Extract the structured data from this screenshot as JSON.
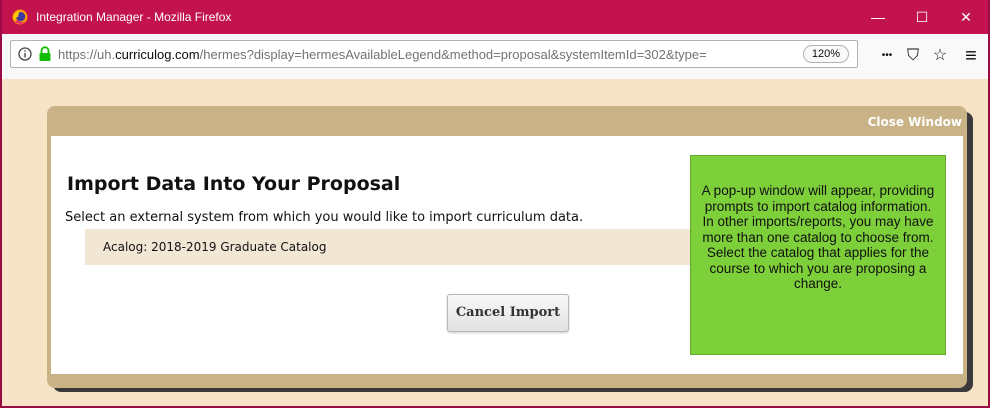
{
  "window": {
    "title": "Integration Manager - Mozilla Firefox",
    "minimize_glyph": "—",
    "maximize_glyph": "☐",
    "close_glyph": "✕"
  },
  "urlbar": {
    "url_prefix": "https://uh.",
    "url_host": "curriculog.com",
    "url_path": "/hermes?display=hermesAvailableLegend&method=proposal&systemItemId=302&type=",
    "zoom": "120%",
    "more_glyph": "•••",
    "pocket_glyph": "⛉",
    "star_glyph": "☆",
    "menu_glyph": "≡"
  },
  "modal": {
    "close_label": "Close Window",
    "heading": "Import Data Into Your Proposal",
    "subtext": "Select an external system from which you would like to import curriculum data.",
    "catalog_option": "Acalog: 2018-2019 Graduate Catalog",
    "cancel_label": "Cancel Import"
  },
  "callout": {
    "text": "A pop-up window will appear, providing prompts to import catalog information. In other imports/reports, you may have more than one catalog to choose from. Select the catalog that applies for the course to which you are proposing a change."
  },
  "colors": {
    "titlebar": "#c2134f",
    "page_background": "#f7e4c7",
    "modal_header": "#c9b285",
    "catalog_row": "#f2e7d5",
    "callout_green": "#7ed03b"
  }
}
